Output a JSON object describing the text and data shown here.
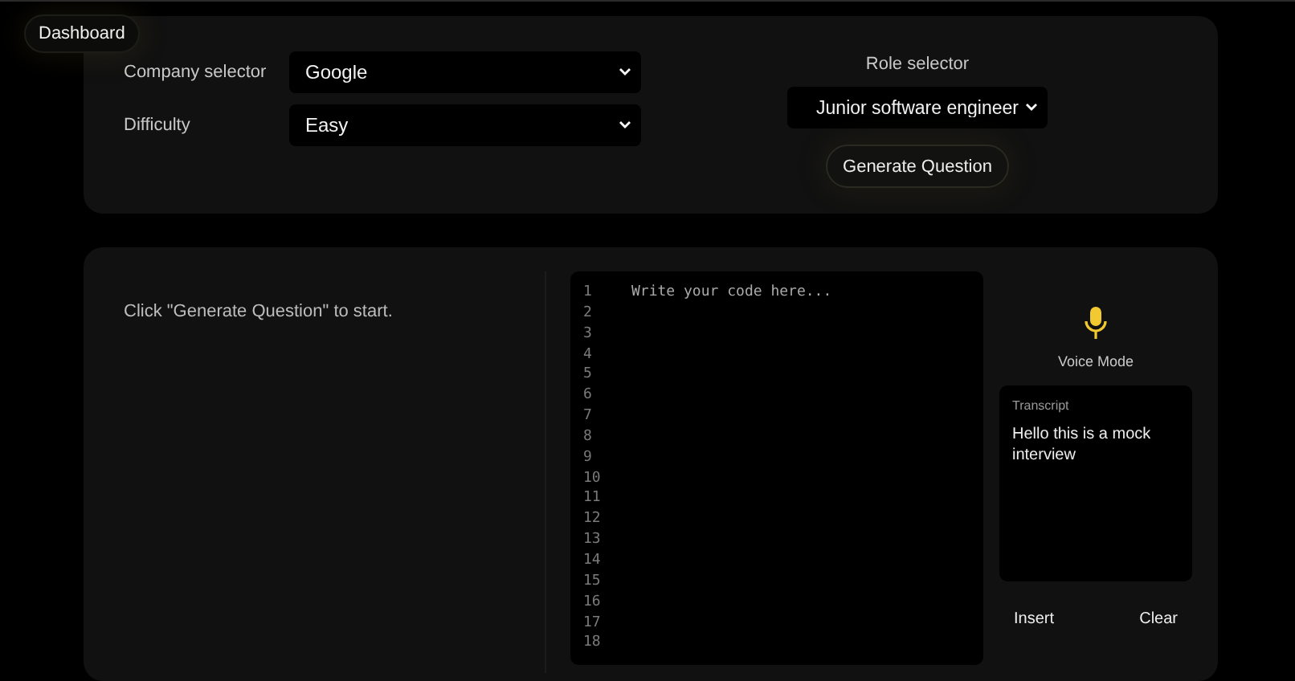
{
  "nav": {
    "dashboard": "Dashboard"
  },
  "settings": {
    "company": {
      "label": "Company selector",
      "value": "Google"
    },
    "difficulty": {
      "label": "Difficulty",
      "value": "Easy"
    },
    "role": {
      "label": "Role selector",
      "value": "Junior software engineer"
    },
    "generate_button": "Generate Question"
  },
  "question": {
    "prompt": "Click \"Generate Question\" to start."
  },
  "editor": {
    "placeholder": "Write your code here...",
    "line_numbers": [
      "1",
      "2",
      "3",
      "4",
      "5",
      "6",
      "7",
      "8",
      "9",
      "10",
      "11",
      "12",
      "13",
      "14",
      "15",
      "16",
      "17",
      "18"
    ]
  },
  "voice": {
    "label": "Voice Mode",
    "transcript_title": "Transcript",
    "transcript": "Hello this is a mock interview",
    "buttons": [
      "Insert",
      "Clear"
    ]
  }
}
